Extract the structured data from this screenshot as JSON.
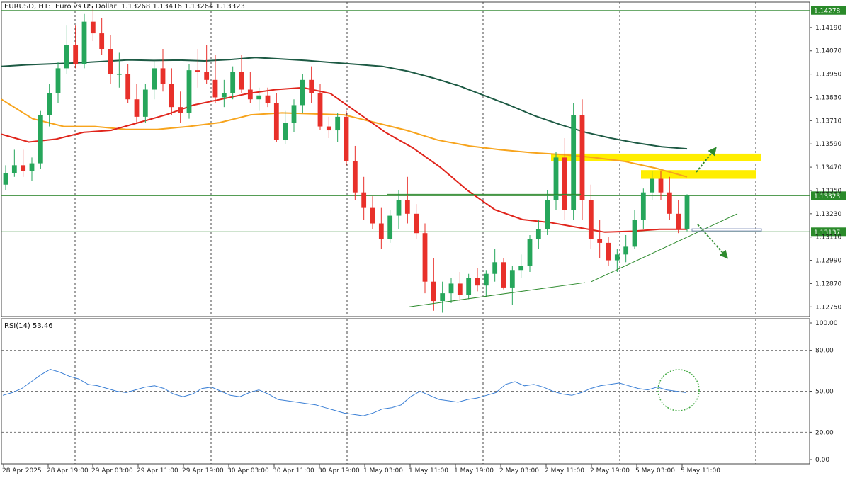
{
  "header": {
    "symbol": "EURUSD",
    "timeframe": "H1",
    "description": "Euro vs US Dollar",
    "ohlc": "1.13268 1.13416 1.13264 1.13323"
  },
  "colors": {
    "bull": "#26a65b",
    "bear": "#e8302a",
    "ma_dark": "#1d5a44",
    "ma_orange": "#f7a41d",
    "ma_red": "#e0241b",
    "trend": "#2c8a2c",
    "zone": "#ffee00",
    "rsi": "#3a7fd5",
    "grid": "#444444",
    "arrow": "#2e8b2e"
  },
  "price_labels": {
    "last": "1.13323",
    "support": "1.13137",
    "top": "1.14278"
  },
  "chart_data": [
    {
      "type": "candlestick",
      "title": "EURUSD, H1: Euro vs US Dollar",
      "ylim": [
        1.127,
        1.1431
      ],
      "y_ticks": [
        "1.14190",
        "1.14070",
        "1.13950",
        "1.13830",
        "1.13710",
        "1.13590",
        "1.13470",
        "1.13350",
        "1.13230",
        "1.13110",
        "1.12990",
        "1.12870",
        "1.12750"
      ],
      "x_ticks": [
        "28 Apr 2025",
        "28 Apr 19:00",
        "29 Apr 03:00",
        "29 Apr 11:00",
        "29 Apr 19:00",
        "30 Apr 03:00",
        "30 Apr 11:00",
        "30 Apr 19:00",
        "1 May 03:00",
        "1 May 11:00",
        "1 May 19:00",
        "2 May 03:00",
        "2 May 11:00",
        "2 May 19:00",
        "5 May 03:00",
        "5 May 11:00"
      ],
      "horizontal_levels": [
        {
          "price": 1.14278,
          "label": "1.14278"
        },
        {
          "price": 1.13323,
          "label": "1.13323"
        },
        {
          "price": 1.13137,
          "label": "1.13137"
        }
      ],
      "moving_averages": [
        {
          "color": "dark-green",
          "values": [
            1.1399,
            1.13998,
            1.14003,
            1.14008,
            1.14015,
            1.14023,
            1.1402,
            1.14022,
            1.14018,
            1.14025,
            1.14035,
            1.14028,
            1.1402,
            1.1401,
            1.14,
            1.1399,
            1.13965,
            1.1393,
            1.1389,
            1.1384,
            1.1379,
            1.13735,
            1.1369,
            1.1365,
            1.1362,
            1.13595,
            1.13575,
            1.13565
          ]
        },
        {
          "color": "orange",
          "values": [
            1.1382,
            1.1372,
            1.1368,
            1.1368,
            1.13665,
            1.13665,
            1.1368,
            1.137,
            1.1374,
            1.1375,
            1.13745,
            1.1374,
            1.137,
            1.1366,
            1.1361,
            1.1358,
            1.1356,
            1.13545,
            1.13535,
            1.1352,
            1.135,
            1.13465,
            1.1342
          ]
        },
        {
          "color": "red",
          "values": [
            1.1364,
            1.136,
            1.13615,
            1.1365,
            1.1366,
            1.137,
            1.1374,
            1.1379,
            1.1382,
            1.1385,
            1.1387,
            1.1388,
            1.1385,
            1.1375,
            1.1365,
            1.1357,
            1.1347,
            1.1335,
            1.1325,
            1.132,
            1.13185,
            1.1316,
            1.13135,
            1.1314,
            1.1315,
            1.1315
          ]
        }
      ],
      "zones": [
        {
          "from": 1.135,
          "to": 1.1354
        },
        {
          "from": 1.1341,
          "to": 1.13455
        }
      ],
      "trendlines": [
        {
          "from": [
            1.1275
          ],
          "to": [
            1.12875
          ]
        },
        {
          "from": [
            1.1288
          ],
          "to": [
            1.1323
          ]
        }
      ],
      "candles": [
        [
          1.1338,
          1.1348,
          1.1335,
          1.1344
        ],
        [
          1.1344,
          1.1356,
          1.1342,
          1.1348
        ],
        [
          1.1348,
          1.1356,
          1.1342,
          1.1345
        ],
        [
          1.1345,
          1.1352,
          1.134,
          1.1349
        ],
        [
          1.1349,
          1.1376,
          1.1346,
          1.1374
        ],
        [
          1.1374,
          1.139,
          1.1368,
          1.1385
        ],
        [
          1.1385,
          1.1401,
          1.138,
          1.1398
        ],
        [
          1.1398,
          1.142,
          1.1395,
          1.141
        ],
        [
          1.141,
          1.142,
          1.1398,
          1.14
        ],
        [
          1.14,
          1.1426,
          1.1398,
          1.1422
        ],
        [
          1.1422,
          1.1429,
          1.1412,
          1.1416
        ],
        [
          1.1416,
          1.1424,
          1.1405,
          1.1408
        ],
        [
          1.1408,
          1.1415,
          1.139,
          1.1395
        ],
        [
          1.1395,
          1.1406,
          1.1388,
          1.1395
        ],
        [
          1.1395,
          1.14,
          1.138,
          1.1382
        ],
        [
          1.1382,
          1.139,
          1.137,
          1.1373
        ],
        [
          1.1373,
          1.139,
          1.137,
          1.1387
        ],
        [
          1.1387,
          1.1402,
          1.1382,
          1.1398
        ],
        [
          1.1398,
          1.1408,
          1.1386,
          1.139
        ],
        [
          1.139,
          1.1398,
          1.1374,
          1.1378
        ],
        [
          1.1378,
          1.1386,
          1.137,
          1.1375
        ],
        [
          1.1375,
          1.14,
          1.1372,
          1.1397
        ],
        [
          1.1397,
          1.1408,
          1.1388,
          1.1396
        ],
        [
          1.1396,
          1.141,
          1.139,
          1.1392
        ],
        [
          1.1392,
          1.1405,
          1.138,
          1.1383
        ],
        [
          1.1383,
          1.1392,
          1.1378,
          1.1385
        ],
        [
          1.1385,
          1.1399,
          1.1382,
          1.1396
        ],
        [
          1.1396,
          1.1405,
          1.1385,
          1.1387
        ],
        [
          1.1387,
          1.1396,
          1.138,
          1.1382
        ],
        [
          1.1382,
          1.1388,
          1.1376,
          1.1384
        ],
        [
          1.1384,
          1.1388,
          1.1378,
          1.138
        ],
        [
          1.138,
          1.1385,
          1.136,
          1.1361
        ],
        [
          1.1361,
          1.1376,
          1.1359,
          1.137
        ],
        [
          1.137,
          1.1382,
          1.1365,
          1.1379
        ],
        [
          1.1379,
          1.1395,
          1.1375,
          1.1392
        ],
        [
          1.1392,
          1.1399,
          1.138,
          1.1385
        ],
        [
          1.1385,
          1.139,
          1.1366,
          1.1368
        ],
        [
          1.1368,
          1.1373,
          1.1362,
          1.1366
        ],
        [
          1.1366,
          1.1375,
          1.136,
          1.1373
        ],
        [
          1.1373,
          1.1376,
          1.1348,
          1.135
        ],
        [
          1.135,
          1.1358,
          1.133,
          1.1334
        ],
        [
          1.1334,
          1.1342,
          1.132,
          1.1326
        ],
        [
          1.1326,
          1.1332,
          1.1315,
          1.1318
        ],
        [
          1.1318,
          1.1326,
          1.1305,
          1.131
        ],
        [
          1.131,
          1.1325,
          1.1308,
          1.1322
        ],
        [
          1.1322,
          1.1335,
          1.1315,
          1.133
        ],
        [
          1.133,
          1.1342,
          1.1318,
          1.1323
        ],
        [
          1.1323,
          1.1328,
          1.131,
          1.1313
        ],
        [
          1.1313,
          1.1318,
          1.1282,
          1.1288
        ],
        [
          1.1288,
          1.13,
          1.1273,
          1.1278
        ],
        [
          1.1278,
          1.1288,
          1.1272,
          1.1282
        ],
        [
          1.1282,
          1.129,
          1.1277,
          1.1287
        ],
        [
          1.1287,
          1.1293,
          1.1278,
          1.1281
        ],
        [
          1.1281,
          1.1292,
          1.1279,
          1.129
        ],
        [
          1.129,
          1.1295,
          1.1283,
          1.1286
        ],
        [
          1.1286,
          1.1294,
          1.128,
          1.1292
        ],
        [
          1.1292,
          1.1305,
          1.1288,
          1.1298
        ],
        [
          1.1298,
          1.13,
          1.1284,
          1.1285
        ],
        [
          1.1285,
          1.1296,
          1.1276,
          1.1294
        ],
        [
          1.1294,
          1.1302,
          1.129,
          1.1296
        ],
        [
          1.1296,
          1.1312,
          1.1293,
          1.131
        ],
        [
          1.131,
          1.132,
          1.1305,
          1.1315
        ],
        [
          1.1315,
          1.1335,
          1.1312,
          1.133
        ],
        [
          1.133,
          1.1355,
          1.1325,
          1.1352
        ],
        [
          1.1352,
          1.1362,
          1.132,
          1.1325
        ],
        [
          1.1325,
          1.138,
          1.132,
          1.1374
        ],
        [
          1.1374,
          1.1382,
          1.132,
          1.133
        ],
        [
          1.133,
          1.1338,
          1.1305,
          1.131
        ],
        [
          1.131,
          1.132,
          1.13,
          1.1308
        ],
        [
          1.1308,
          1.1311,
          1.1296,
          1.1299
        ],
        [
          1.1299,
          1.1305,
          1.1293,
          1.1302
        ],
        [
          1.1302,
          1.1312,
          1.1298,
          1.1306
        ],
        [
          1.1306,
          1.1325,
          1.1305,
          1.132
        ],
        [
          1.132,
          1.1336,
          1.1315,
          1.1334
        ],
        [
          1.1334,
          1.1345,
          1.133,
          1.1341
        ],
        [
          1.1341,
          1.1345,
          1.133,
          1.1334
        ],
        [
          1.1334,
          1.1342,
          1.132,
          1.1323
        ],
        [
          1.1323,
          1.133,
          1.1313,
          1.1315
        ],
        [
          1.1315,
          1.1333,
          1.1314,
          1.13323
        ]
      ]
    },
    {
      "type": "line",
      "title": "RSI(14) 53.46",
      "ylim": [
        0,
        100
      ],
      "y_ticks": [
        "100.00",
        "80.00",
        "50.00",
        "20.00",
        "0.00"
      ],
      "values": [
        47,
        49,
        52,
        57,
        62,
        66,
        64,
        61,
        59,
        55,
        54,
        52,
        50,
        49,
        51,
        53,
        54,
        52,
        48,
        46,
        48,
        52,
        53,
        50,
        47,
        46,
        49,
        51,
        48,
        44,
        43,
        42,
        41,
        40,
        38,
        36,
        34,
        33,
        32,
        34,
        37,
        38,
        40,
        46,
        50,
        47,
        44,
        43,
        42,
        44,
        45,
        47,
        49,
        55,
        57,
        54,
        55,
        53,
        50,
        48,
        47,
        49,
        52,
        54,
        55,
        56,
        54,
        52,
        51,
        53,
        51,
        50,
        49
      ]
    }
  ]
}
